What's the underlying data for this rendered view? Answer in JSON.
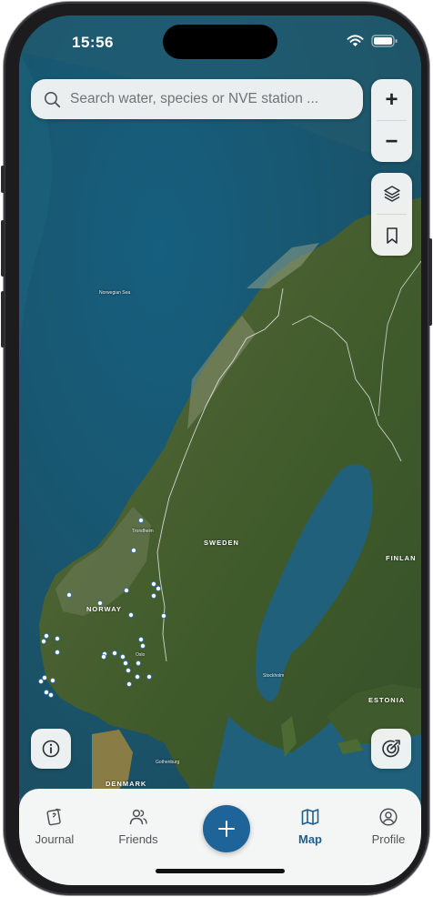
{
  "status_bar": {
    "time": "15:56"
  },
  "search": {
    "placeholder": "Search water, species or NVE station ..."
  },
  "map_controls": {
    "zoom_in": "+",
    "zoom_out": "−"
  },
  "map_labels": {
    "sweden": "SWEDEN",
    "norway": "NORWAY",
    "finland": "FINLAN",
    "estonia": "ESTONIA",
    "denmark": "DENMARK",
    "norwegian_sea": "Norwegian Sea",
    "oslo": "Oslo",
    "stockholm": "Stockholm",
    "trondheim": "Trondheim",
    "gothenburg": "Gothenburg"
  },
  "tabs": [
    {
      "label": "Journal",
      "icon": "journal-icon"
    },
    {
      "label": "Friends",
      "icon": "friends-icon"
    },
    {
      "label": "Map",
      "icon": "map-icon"
    },
    {
      "label": "Profile",
      "icon": "profile-icon"
    }
  ],
  "active_tab": "Map",
  "colors": {
    "accent": "#1f6499",
    "tab_active": "#1f5d8c",
    "sea": "#1d5a72",
    "land": "#4e6a2e",
    "marker": "#ffffff"
  }
}
